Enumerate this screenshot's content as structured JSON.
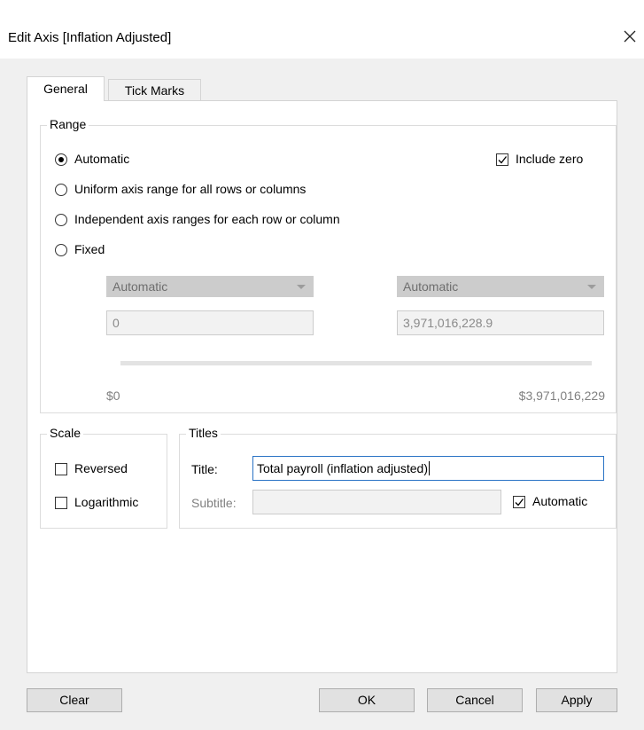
{
  "window": {
    "title": "Edit Axis [Inflation Adjusted]"
  },
  "tabs": [
    {
      "label": "General",
      "active": true
    },
    {
      "label": "Tick Marks",
      "active": false
    }
  ],
  "range": {
    "legend": "Range",
    "options": [
      {
        "label": "Automatic",
        "selected": true
      },
      {
        "label": "Uniform axis range for all rows or columns",
        "selected": false
      },
      {
        "label": "Independent axis ranges for each row or column",
        "selected": false
      },
      {
        "label": "Fixed",
        "selected": false
      }
    ],
    "include_zero": {
      "label": "Include zero",
      "checked": true
    },
    "start": {
      "mode": "Automatic",
      "value": "0",
      "display": "$0"
    },
    "end": {
      "mode": "Automatic",
      "value": "3,971,016,228.9",
      "display": "$3,971,016,229"
    }
  },
  "scale": {
    "legend": "Scale",
    "reversed": {
      "label": "Reversed",
      "checked": false
    },
    "logarithmic": {
      "label": "Logarithmic",
      "checked": false
    }
  },
  "titles": {
    "legend": "Titles",
    "title_label": "Title:",
    "title_value": "Total payroll (inflation adjusted)",
    "subtitle_label": "Subtitle:",
    "subtitle_value": "",
    "automatic": {
      "label": "Automatic",
      "checked": true
    }
  },
  "buttons": {
    "clear": "Clear",
    "ok": "OK",
    "cancel": "Cancel",
    "apply": "Apply"
  },
  "colors": {
    "focus_border": "#2a73c5",
    "disabled_fill": "#cccccc",
    "dialog_bg": "#f0f0f0"
  }
}
